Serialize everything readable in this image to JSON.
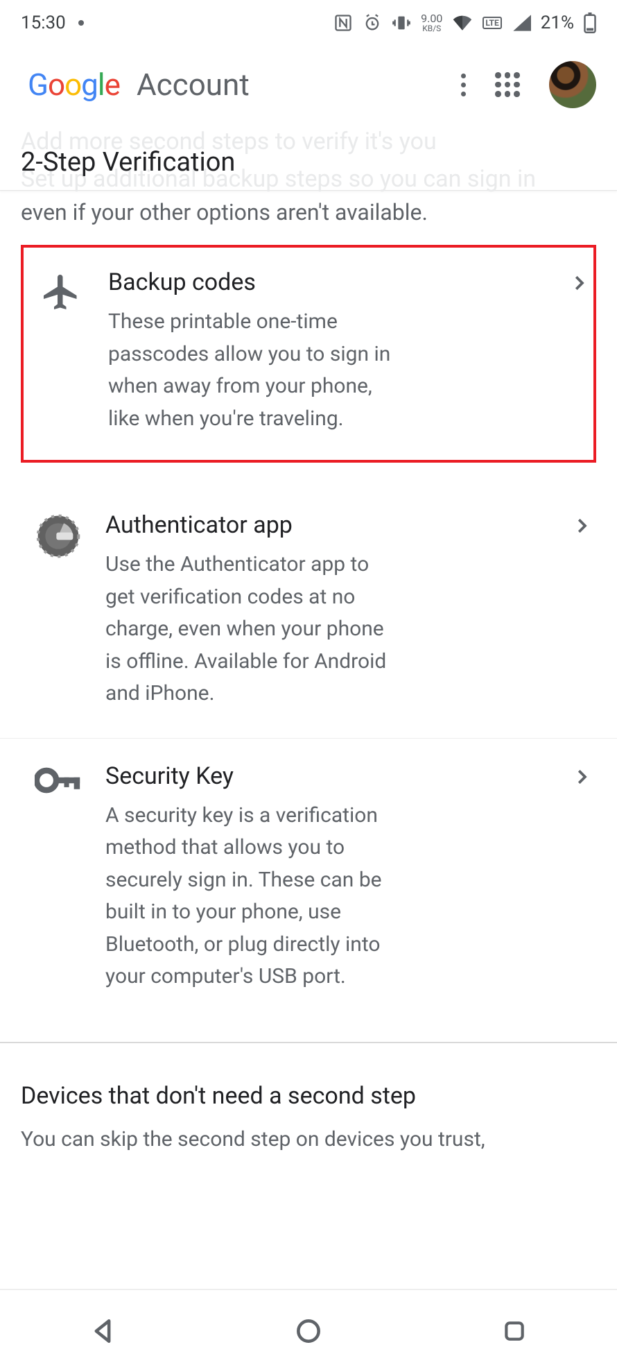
{
  "status": {
    "time": "15:30",
    "data_rate_value": "9.00",
    "data_rate_unit": "KB/S",
    "lte_badge": "LTE",
    "battery_text": "21%"
  },
  "header": {
    "logo_text": "Google",
    "account_word": "Account",
    "subtitle": "2-Step Verification",
    "ghost_line1": "Add more second steps to verify it's you",
    "ghost_line2": "Set up additional backup steps so you can sign in",
    "ghost_remainder": "even if your other options aren't available."
  },
  "options": {
    "backup_codes": {
      "title": "Backup codes",
      "desc": "These printable one-time passcodes allow you to sign in when away from your phone, like when you're traveling."
    },
    "authenticator": {
      "title": "Authenticator app",
      "desc": "Use the Authenticator app to get verification codes at no charge, even when your phone is offline. Available for Android and iPhone."
    },
    "security_key": {
      "title": "Security Key",
      "desc": "A security key is a verification method that allows you to securely sign in. These can be built in to your phone, use Bluetooth, or plug directly into your computer's USB port."
    }
  },
  "devices_section": {
    "heading": "Devices that don't need a second step",
    "body": "You can skip the second step on devices you trust,"
  }
}
